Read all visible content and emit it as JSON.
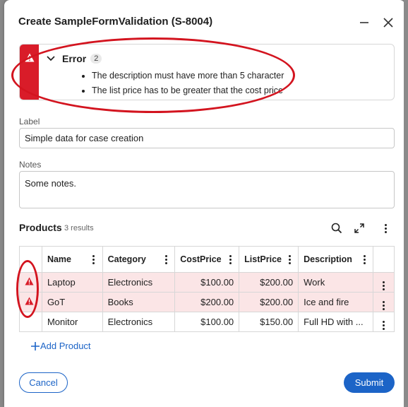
{
  "dialog": {
    "title": "Create SampleFormValidation (S-8004)"
  },
  "error_panel": {
    "title": "Error",
    "count": "2",
    "messages": [
      "The description must have more than 5 character",
      "The list price has to be greater that the cost price"
    ]
  },
  "form": {
    "label_field": {
      "label": "Label",
      "value": "Simple data for case creation"
    },
    "notes_field": {
      "label": "Notes",
      "value": "Some notes."
    }
  },
  "products": {
    "title": "Products",
    "count": "3 results",
    "columns": [
      "Name",
      "Category",
      "CostPrice",
      "ListPrice",
      "Description"
    ],
    "rows": [
      {
        "name": "Laptop",
        "category": "Electronics",
        "cost": "$100.00",
        "list": "$200.00",
        "description": "Work",
        "error": true
      },
      {
        "name": "GoT",
        "category": "Books",
        "cost": "$200.00",
        "list": "$200.00",
        "description": "Ice and fire",
        "error": true
      },
      {
        "name": "Monitor",
        "category": "Electronics",
        "cost": "$100.00",
        "list": "$150.00",
        "description": "Full HD with ...",
        "error": false
      }
    ],
    "add_label": "Add Product"
  },
  "buttons": {
    "cancel": "Cancel",
    "submit": "Submit"
  },
  "colors": {
    "error": "#d91c29",
    "error_row": "#fbe5e6",
    "primary": "#1c64c7",
    "annotation": "#d3141f"
  },
  "icons": [
    "close-icon",
    "minimize-icon",
    "warning-icon",
    "chevron-down-icon",
    "search-icon",
    "expand-icon",
    "more-icon",
    "plus-icon"
  ]
}
